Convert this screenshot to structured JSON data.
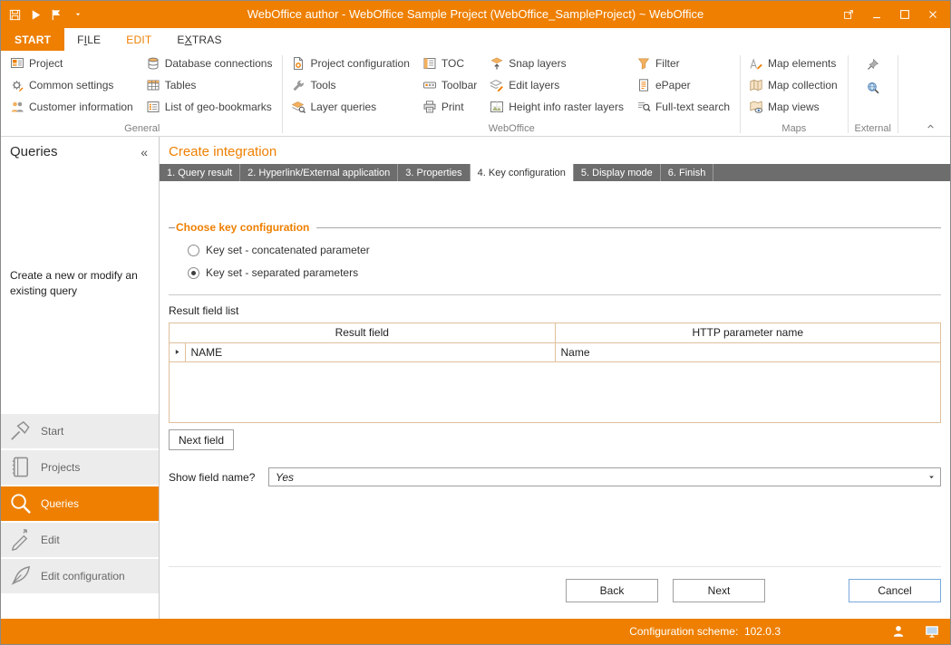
{
  "window": {
    "title": "WebOffice author - WebOffice Sample Project (WebOffice_SampleProject) ~ WebOffice"
  },
  "tabs": {
    "start": "START",
    "file": {
      "pre": "F",
      "accel": "I",
      "post": "LE"
    },
    "edit": "EDIT",
    "extras": {
      "pre": "E",
      "accel": "X",
      "post": "TRAS"
    }
  },
  "ribbon": {
    "groups": [
      {
        "name": "General",
        "items": [
          {
            "label": "Project",
            "icon": "project-icon"
          },
          {
            "label": "Common settings",
            "icon": "common-settings-icon"
          },
          {
            "label": "Customer information",
            "icon": "customer-information-icon"
          },
          {
            "label": "Database connections",
            "icon": "database-connections-icon"
          },
          {
            "label": "Tables",
            "icon": "tables-icon"
          },
          {
            "label": "List of geo-bookmarks",
            "icon": "geo-bookmarks-icon"
          }
        ]
      },
      {
        "name": "WebOffice",
        "items": [
          {
            "label": "Project configuration",
            "icon": "project-configuration-icon"
          },
          {
            "label": "Tools",
            "icon": "tools-icon"
          },
          {
            "label": "Layer queries",
            "icon": "layer-queries-icon"
          },
          {
            "label": "TOC",
            "icon": "toc-icon"
          },
          {
            "label": "Toolbar",
            "icon": "toolbar-icon"
          },
          {
            "label": "Print",
            "icon": "print-icon"
          },
          {
            "label": "Snap layers",
            "icon": "snap-layers-icon"
          },
          {
            "label": "Edit layers",
            "icon": "edit-layers-icon"
          },
          {
            "label": "Height info raster layers",
            "icon": "height-info-raster-layers-icon"
          },
          {
            "label": "Filter",
            "icon": "filter-icon"
          },
          {
            "label": "ePaper",
            "icon": "epaper-icon"
          },
          {
            "label": "Full-text search",
            "icon": "full-text-search-icon"
          }
        ]
      },
      {
        "name": "Maps",
        "items": [
          {
            "label": "Map elements",
            "icon": "map-elements-icon"
          },
          {
            "label": "Map collection",
            "icon": "map-collection-icon"
          },
          {
            "label": "Map views",
            "icon": "map-views-icon"
          }
        ]
      },
      {
        "name": "External",
        "items": [
          {
            "icon": "pin-icon"
          },
          {
            "icon": "external-search-icon"
          }
        ]
      }
    ]
  },
  "sidebar": {
    "title": "Queries",
    "collapse_glyph": "«",
    "description": "Create a new or modify an existing query",
    "nav": [
      {
        "label": "Start",
        "icon": "start-icon",
        "active": false
      },
      {
        "label": "Projects",
        "icon": "projects-icon",
        "active": false
      },
      {
        "label": "Queries",
        "icon": "queries-icon",
        "active": true
      },
      {
        "label": "Edit",
        "icon": "edit-icon",
        "active": false
      },
      {
        "label": "Edit configuration",
        "icon": "edit-configuration-icon",
        "active": false
      }
    ]
  },
  "main": {
    "title": "Create integration",
    "wizard_steps": [
      {
        "label": "1. Query result",
        "active": false
      },
      {
        "label": "2. Hyperlink/External application",
        "active": false
      },
      {
        "label": "3. Properties",
        "active": false
      },
      {
        "label": "4. Key configuration",
        "active": true
      },
      {
        "label": "5. Display mode",
        "active": false
      },
      {
        "label": "6. Finish",
        "active": false
      }
    ],
    "key_config": {
      "legend": "Choose key configuration",
      "options": [
        {
          "label": "Key set - concatenated parameter",
          "selected": false
        },
        {
          "label": "Key set - separated parameters",
          "selected": true
        }
      ]
    },
    "result_fields": {
      "label": "Result field list",
      "columns": [
        "Result field",
        "HTTP parameter name"
      ],
      "rows": [
        {
          "result_field": "NAME",
          "http_parameter_name": "Name"
        }
      ]
    },
    "next_field_button": "Next field",
    "show_field_name": {
      "label": "Show field name?",
      "value": "Yes"
    },
    "buttons": {
      "back": "Back",
      "next": "Next",
      "cancel": "Cancel"
    }
  },
  "statusbar": {
    "text": "Configuration scheme:  102.0.3",
    "icons": [
      "user-icon",
      "monitor-icon"
    ]
  },
  "colors": {
    "accent_orange": "#ee7f00",
    "wizard_bar_gray": "#6d6d6d",
    "table_border": "#dfc09c"
  }
}
